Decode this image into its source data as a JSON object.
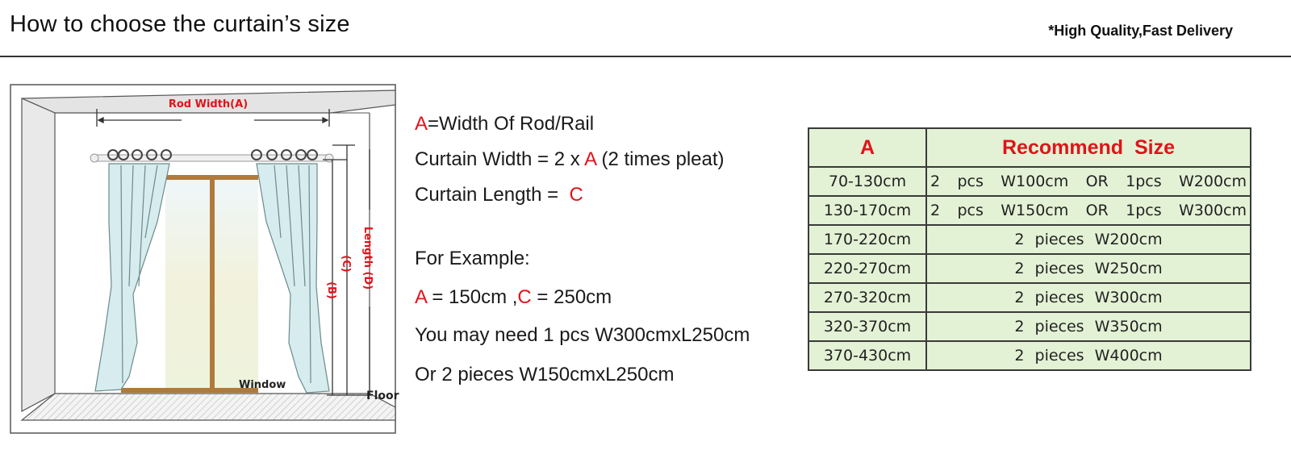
{
  "header": {
    "title": "How to choose the curtain’s size",
    "tagline": "*High Quality,Fast Delivery"
  },
  "diagram": {
    "rod_width_label": "Rod Width(A)",
    "length_d_label": "Length (D)",
    "length_c_label": "(C)",
    "length_b_label": "(B)",
    "window_label": "Window",
    "floor_label": "Floor"
  },
  "explanation": {
    "line1": {
      "highlight": "A",
      "text": "=Width Of Rod/Rail"
    },
    "line2": {
      "prefix": "Curtain Width = 2 x ",
      "highlight": "A",
      "suffix": " (2 times pleat)"
    },
    "line3": {
      "prefix": "Curtain Length =  ",
      "highlight": "C"
    },
    "example_heading": "For Example:",
    "example_values": {
      "a_label": "A",
      "a_text": " = 150cm ,",
      "c_label": "C",
      "c_text": " = 250cm"
    },
    "example_line1": "You may need 1 pcs W300cmxL250cm",
    "example_line2": "Or 2 pieces W150cmxL250cm"
  },
  "size_table": {
    "headers": [
      "A",
      "Recommend Size"
    ],
    "rows": [
      {
        "range": "70-130cm",
        "recommend": "2 pcs W100cm OR 1pcs W200cm"
      },
      {
        "range": "130-170cm",
        "recommend": "2 pcs W150cm OR 1pcs W300cm"
      },
      {
        "range": "170-220cm",
        "recommend": "2 pieces W200cm"
      },
      {
        "range": "220-270cm",
        "recommend": "2 pieces W250cm"
      },
      {
        "range": "270-320cm",
        "recommend": "2 pieces W300cm"
      },
      {
        "range": "320-370cm",
        "recommend": "2 pieces W350cm"
      },
      {
        "range": "370-430cm",
        "recommend": "2 pieces W400cm"
      }
    ]
  },
  "colors": {
    "accent_red": "#e0141a",
    "table_bg": "#e3f2d5",
    "curtain": "#d6ecee",
    "window_frame": "#b07a3c"
  }
}
